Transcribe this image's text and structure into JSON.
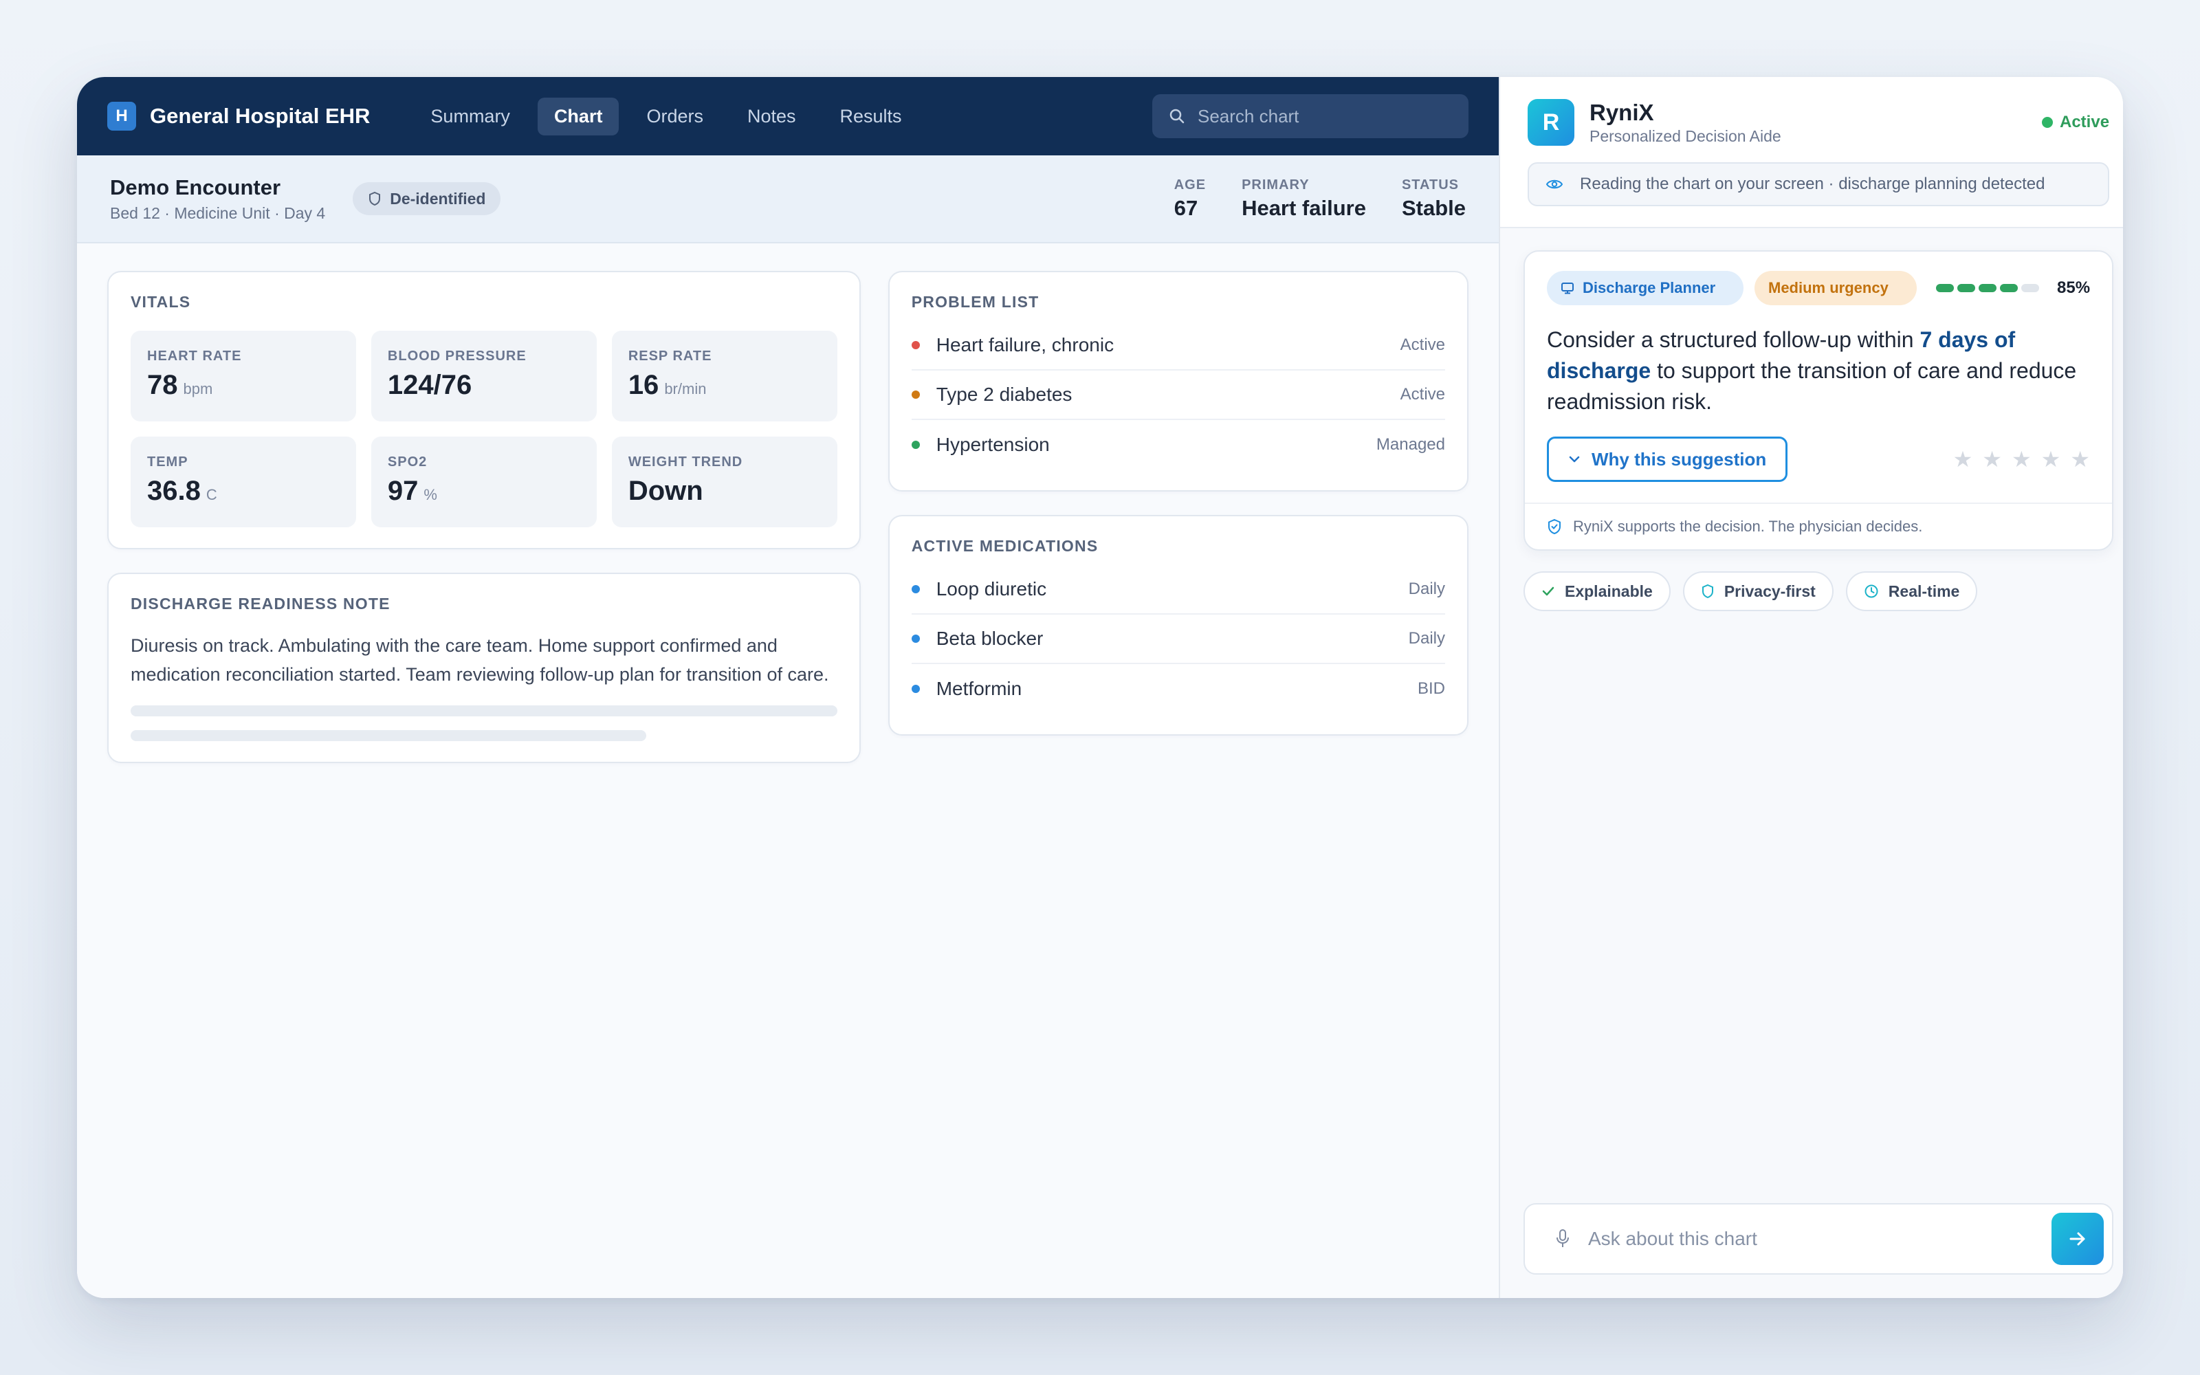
{
  "app": {
    "logo_letter": "H",
    "title": "General Hospital EHR"
  },
  "nav": {
    "tabs": [
      {
        "label": "Summary",
        "active": false
      },
      {
        "label": "Chart",
        "active": true
      },
      {
        "label": "Orders",
        "active": false
      },
      {
        "label": "Notes",
        "active": false
      },
      {
        "label": "Results",
        "active": false
      }
    ]
  },
  "search": {
    "placeholder": "Search chart"
  },
  "encounter": {
    "title": "Demo Encounter",
    "subtitle": "Bed 12 · Medicine Unit · Day 4",
    "badge": "De-identified",
    "stats": [
      {
        "label": "AGE",
        "value": "67"
      },
      {
        "label": "PRIMARY",
        "value": "Heart failure"
      },
      {
        "label": "STATUS",
        "value": "Stable"
      }
    ]
  },
  "vitals": {
    "title": "Vitals",
    "items": [
      {
        "label": "HEART RATE",
        "value": "78",
        "unit": "bpm"
      },
      {
        "label": "BLOOD PRESSURE",
        "value": "124/76",
        "unit": ""
      },
      {
        "label": "RESP RATE",
        "value": "16",
        "unit": "br/min"
      },
      {
        "label": "TEMP",
        "value": "36.8",
        "unit": "C"
      },
      {
        "label": "SPO2",
        "value": "97",
        "unit": "%"
      },
      {
        "label": "WEIGHT TREND",
        "value": "Down",
        "unit": ""
      }
    ]
  },
  "note": {
    "title": "Discharge Readiness Note",
    "text": "Diuresis on track. Ambulating with the care team. Home support confirmed and medication reconciliation started. Team reviewing follow-up plan for transition of care."
  },
  "problems": {
    "title": "Problem List",
    "items": [
      {
        "name": "Heart failure, chronic",
        "status": "Active",
        "color": "#e0524a"
      },
      {
        "name": "Type 2 diabetes",
        "status": "Active",
        "color": "#d07a14"
      },
      {
        "name": "Hypertension",
        "status": "Managed",
        "color": "#2ea35e"
      }
    ]
  },
  "medications": {
    "title": "Active Medications",
    "items": [
      {
        "name": "Loop diuretic",
        "freq": "Daily",
        "color": "#2b8be0"
      },
      {
        "name": "Beta blocker",
        "freq": "Daily",
        "color": "#2b8be0"
      },
      {
        "name": "Metformin",
        "freq": "BID",
        "color": "#2b8be0"
      }
    ]
  },
  "aide": {
    "logo_letter": "R",
    "name": "RyniX",
    "tagline": "Personalized Decision Aide",
    "status": "Active",
    "reading": "Reading the chart on your screen · discharge planning detected"
  },
  "suggestion": {
    "tag_planner": "Discharge Planner",
    "tag_urgency": "Medium urgency",
    "confidence_segments_on": 4,
    "confidence_segments_total": 5,
    "confidence_pct": "85%",
    "text_before": "Consider a structured follow-up within ",
    "text_highlight": "7 days of discharge",
    "text_after": " to support the transition of care and reduce readmission risk.",
    "why_label": "Why this suggestion",
    "rating": 0,
    "rating_max": 5,
    "footer": "RyniX supports the decision. The physician decides."
  },
  "chips": [
    {
      "label": "Explainable",
      "icon": "check-icon"
    },
    {
      "label": "Privacy-first",
      "icon": "shield-icon"
    },
    {
      "label": "Real-time",
      "icon": "clock-icon"
    }
  ],
  "ask": {
    "placeholder": "Ask about this chart"
  },
  "colors": {
    "navy": "#112e55",
    "accent": "#1f8fe0",
    "active_green": "#2fb566",
    "urgency_orange": "#c2720e"
  }
}
